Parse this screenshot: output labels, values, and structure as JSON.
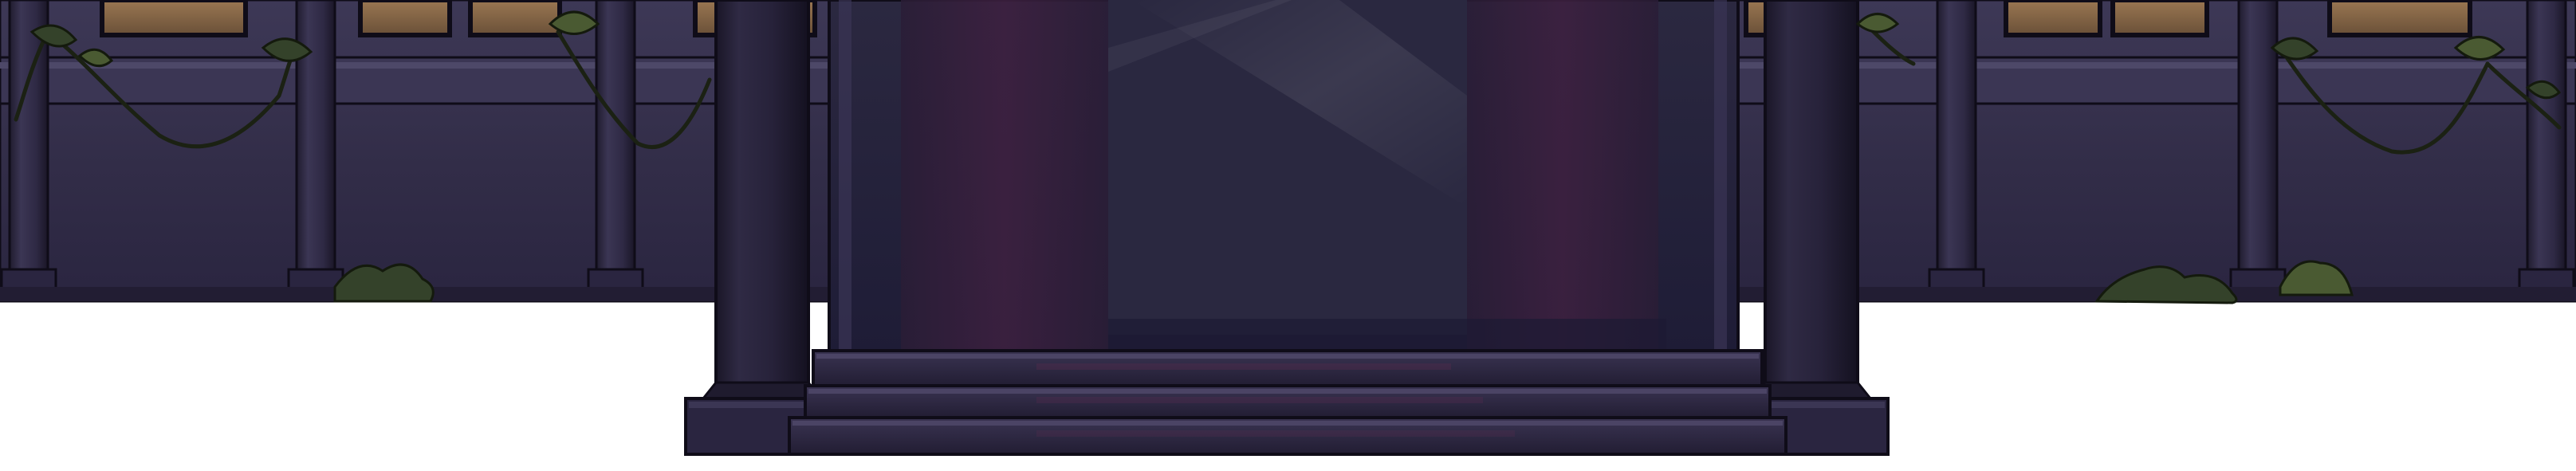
{
  "scene": {
    "kind": "building-facade-entrance",
    "palette": {
      "background": "#ffffff",
      "wall": "#35304c",
      "wall_dark": "#272239",
      "wall_light": "#4a4563",
      "outline": "#0f0c18",
      "window_glow": "#8a6a4c",
      "window_glow_dark": "#5e4734",
      "door_glass": "#24213a",
      "curtain": "#3a1f3a",
      "step": "#2a2440",
      "step_light": "#3b3556",
      "ivy": "#2e3a22",
      "ivy_light": "#4a5a32"
    },
    "elements": {
      "left_wing": "facade-left-wing",
      "right_wing": "facade-right-wing",
      "entrance": "entrance-doorway",
      "steps": "entrance-steps",
      "ivy": "ivy-vines"
    }
  }
}
